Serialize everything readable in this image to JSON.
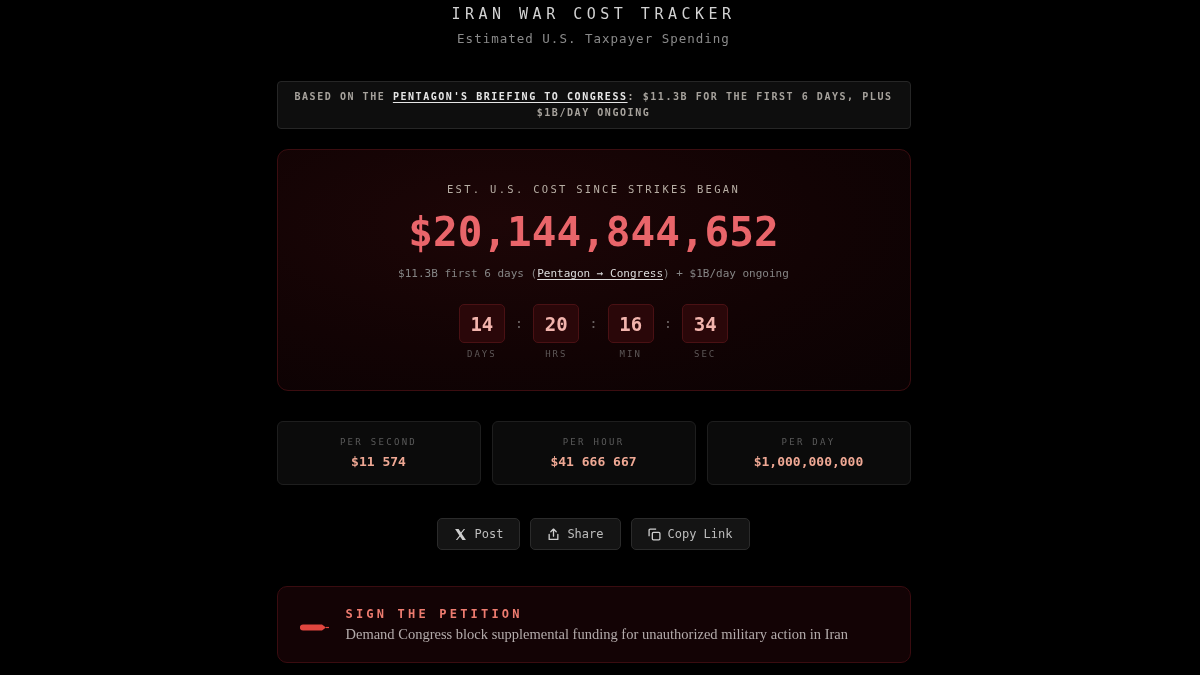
{
  "header": {
    "title": "IRAN WAR COST TRACKER",
    "subtitle": "Estimated U.S. Taxpayer Spending"
  },
  "source_note": {
    "before": "BASED ON THE ",
    "link": "PENTAGON'S BRIEFING TO CONGRESS",
    "after": ": $11.3B FOR THE FIRST 6 DAYS, PLUS $1B/DAY ONGOING"
  },
  "cost_card": {
    "label": "EST. U.S. COST SINCE STRIKES BEGAN",
    "amount": "$20,144,844,652",
    "basis": {
      "before": "$11.3B first 6 days (",
      "link": "Pentagon → Congress",
      "after": ") + $1B/day ongoing"
    },
    "countdown": [
      {
        "value": "14",
        "unit": "DAYS",
        "separator": ":"
      },
      {
        "value": "20",
        "unit": "HRS",
        "separator": ":"
      },
      {
        "value": "16",
        "unit": "MIN",
        "separator": ":"
      },
      {
        "value": "34",
        "unit": "SEC"
      }
    ]
  },
  "rates": [
    {
      "label": "PER SECOND",
      "value": "$11 574"
    },
    {
      "label": "PER HOUR",
      "value": "$41 666 667"
    },
    {
      "label": "PER DAY",
      "value": "$1,000,000,000"
    }
  ],
  "share_buttons": [
    {
      "kind": "post",
      "label": "Post"
    },
    {
      "kind": "share",
      "label": "Share"
    },
    {
      "kind": "copy",
      "label": "Copy Link"
    }
  ],
  "petition": {
    "title": "SIGN THE PETITION",
    "text": "Demand Congress block supplemental funding for unauthorized military action in Iran"
  }
}
